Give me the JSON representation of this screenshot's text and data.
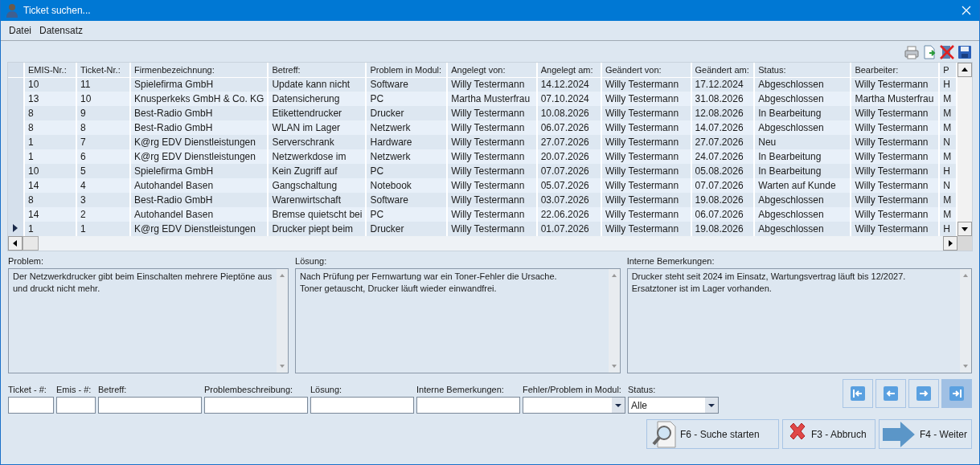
{
  "window": {
    "title": "Ticket suchen..."
  },
  "menu": [
    "Datei",
    "Datensatz"
  ],
  "toolbar": [
    {
      "kind": "print"
    },
    {
      "kind": "export"
    },
    {
      "kind": "delete"
    },
    {
      "kind": "save"
    }
  ],
  "grid": {
    "columns": [
      "EMIS-Nr.:",
      "Ticket-Nr.:",
      "Firmenbezeichnung:",
      "Betreff:",
      "Problem in Modul:",
      "Angelegt von:",
      "Angelegt am:",
      "Geändert von:",
      "Geändert am:",
      "Status:",
      "Bearbeiter:",
      "P"
    ],
    "rows": [
      {
        "current": false,
        "cells": [
          "10",
          "11",
          "Spielefirma GmbH",
          "Update kann nicht",
          "Software",
          "Willy Testermann",
          "14.12.2024",
          "Willy Testermann",
          "17.12.2024",
          "Abgeschlossen",
          "Willy Testermann",
          "H"
        ]
      },
      {
        "current": false,
        "cells": [
          "13",
          "10",
          "Knusperkeks GmbH & Co. KG",
          "Datensicherung",
          "PC",
          "Martha Musterfrau",
          "07.10.2024",
          "Willy Testermann",
          "31.08.2026",
          "Abgeschlossen",
          "Martha Musterfrau",
          "M"
        ]
      },
      {
        "current": false,
        "cells": [
          "8",
          "9",
          "Best-Radio GmbH",
          "Etikettendrucker",
          "Drucker",
          "Willy Testermann",
          "10.08.2026",
          "Willy Testermann",
          "12.08.2026",
          "In Bearbeitung",
          "Willy Testermann",
          "M"
        ]
      },
      {
        "current": false,
        "cells": [
          "8",
          "8",
          "Best-Radio GmbH",
          "WLAN im Lager",
          "Netzwerk",
          "Willy Testermann",
          "06.07.2026",
          "Willy Testermann",
          "14.07.2026",
          "Abgeschlossen",
          "Willy Testermann",
          "M"
        ]
      },
      {
        "current": false,
        "cells": [
          "1",
          "7",
          "K@rg EDV Dienstleistungen",
          "Serverschrank",
          "Hardware",
          "Willy Testermann",
          "27.07.2026",
          "Willy Testermann",
          "27.07.2026",
          "Neu",
          "Willy Testermann",
          "N"
        ]
      },
      {
        "current": false,
        "cells": [
          "1",
          "6",
          "K@rg EDV Dienstleistungen",
          "Netzwerkdose im",
          "Netzwerk",
          "Willy Testermann",
          "20.07.2026",
          "Willy Testermann",
          "24.07.2026",
          "In Bearbeitung",
          "Willy Testermann",
          "M"
        ]
      },
      {
        "current": false,
        "cells": [
          "10",
          "5",
          "Spielefirma GmbH",
          "Kein Zugriff auf",
          "PC",
          "Willy Testermann",
          "07.07.2026",
          "Willy Testermann",
          "05.08.2026",
          "In Bearbeitung",
          "Willy Testermann",
          "H"
        ]
      },
      {
        "current": false,
        "cells": [
          "14",
          "4",
          "Autohandel Basen",
          "Gangschaltung",
          "Notebook",
          "Willy Testermann",
          "05.07.2026",
          "Willy Testermann",
          "07.07.2026",
          "Warten auf Kunde",
          "Willy Testermann",
          "N"
        ]
      },
      {
        "current": false,
        "cells": [
          "8",
          "3",
          "Best-Radio GmbH",
          "Warenwirtschaft",
          "Software",
          "Willy Testermann",
          "03.07.2026",
          "Willy Testermann",
          "19.08.2026",
          "Abgeschlossen",
          "Willy Testermann",
          "M"
        ]
      },
      {
        "current": false,
        "cells": [
          "14",
          "2",
          "Autohandel Basen",
          "Bremse quietscht bei",
          "PC",
          "Willy Testermann",
          "22.06.2026",
          "Willy Testermann",
          "06.07.2026",
          "Abgeschlossen",
          "Willy Testermann",
          "M"
        ]
      },
      {
        "current": true,
        "cells": [
          "1",
          "1",
          "K@rg EDV Dienstleistungen",
          "Drucker piept beim",
          "Drucker",
          "Willy Testermann",
          "01.07.2026",
          "Willy Testermann",
          "19.08.2026",
          "Abgeschlossen",
          "Willy Testermann",
          "H"
        ]
      }
    ]
  },
  "memos": [
    {
      "label": "Problem:",
      "text": "Der Netzwerkdrucker gibt beim Einschalten mehrere Pieptöne aus und druckt nicht mehr."
    },
    {
      "label": "Lösung:",
      "text": "Nach Prüfung per Fernwartung war ein Toner-Fehler die Ursache.\nToner getauscht, Drucker läuft wieder einwandfrei."
    },
    {
      "label": "Interne Bemerkungen:",
      "text": "Drucker steht seit 2024 im Einsatz, Wartungsvertrag läuft bis 12/2027.\nErsatztoner ist im Lager vorhanden."
    }
  ],
  "filters": [
    {
      "label": "Ticket - #:",
      "kind": "text"
    },
    {
      "label": "Emis - #:",
      "kind": "text"
    },
    {
      "label": "Betreff:",
      "kind": "text"
    },
    {
      "label": "Problembeschreibung:",
      "kind": "text"
    },
    {
      "label": "Lösung:",
      "kind": "text"
    },
    {
      "label": "Interne Bemerkungen:",
      "kind": "text"
    },
    {
      "label": "Fehler/Problem in Modul:",
      "kind": "combo"
    },
    {
      "label": "Status:",
      "kind": "combo",
      "value": "Alle"
    }
  ],
  "nav_buttons": [
    {
      "kind": "first",
      "active": false
    },
    {
      "kind": "prev",
      "active": false
    },
    {
      "kind": "next",
      "active": false
    },
    {
      "kind": "last",
      "active": true
    }
  ],
  "actions": [
    {
      "kind": "search",
      "label": "F6 - Suche starten"
    },
    {
      "kind": "cancel",
      "label": "F3 - Abbruch"
    },
    {
      "kind": "next",
      "label": "F4 - Weiter"
    }
  ]
}
